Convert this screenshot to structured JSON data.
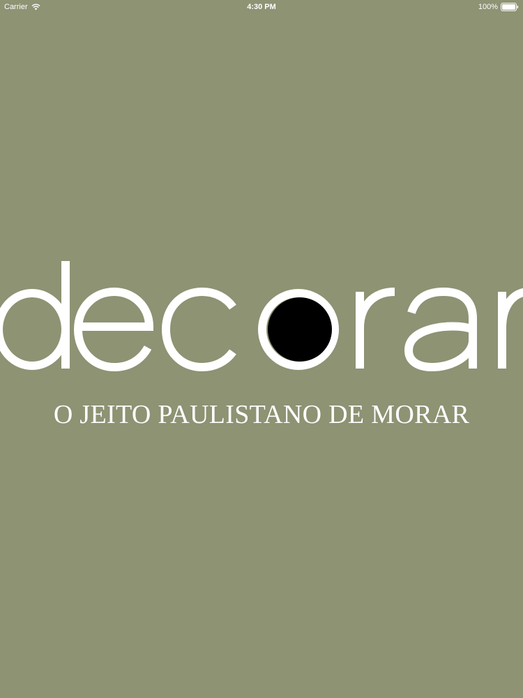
{
  "status_bar": {
    "carrier": "Carrier",
    "time": "4:30 PM",
    "battery": "100%",
    "icons": [
      "wifi-icon",
      "battery-icon"
    ]
  },
  "splash": {
    "logo_text": "decorar",
    "tagline": "O JEITO PAULISTANO DE MORAR",
    "colors": {
      "background": "#8d9373",
      "logo": "#ffffff",
      "dot": "#000000"
    }
  }
}
